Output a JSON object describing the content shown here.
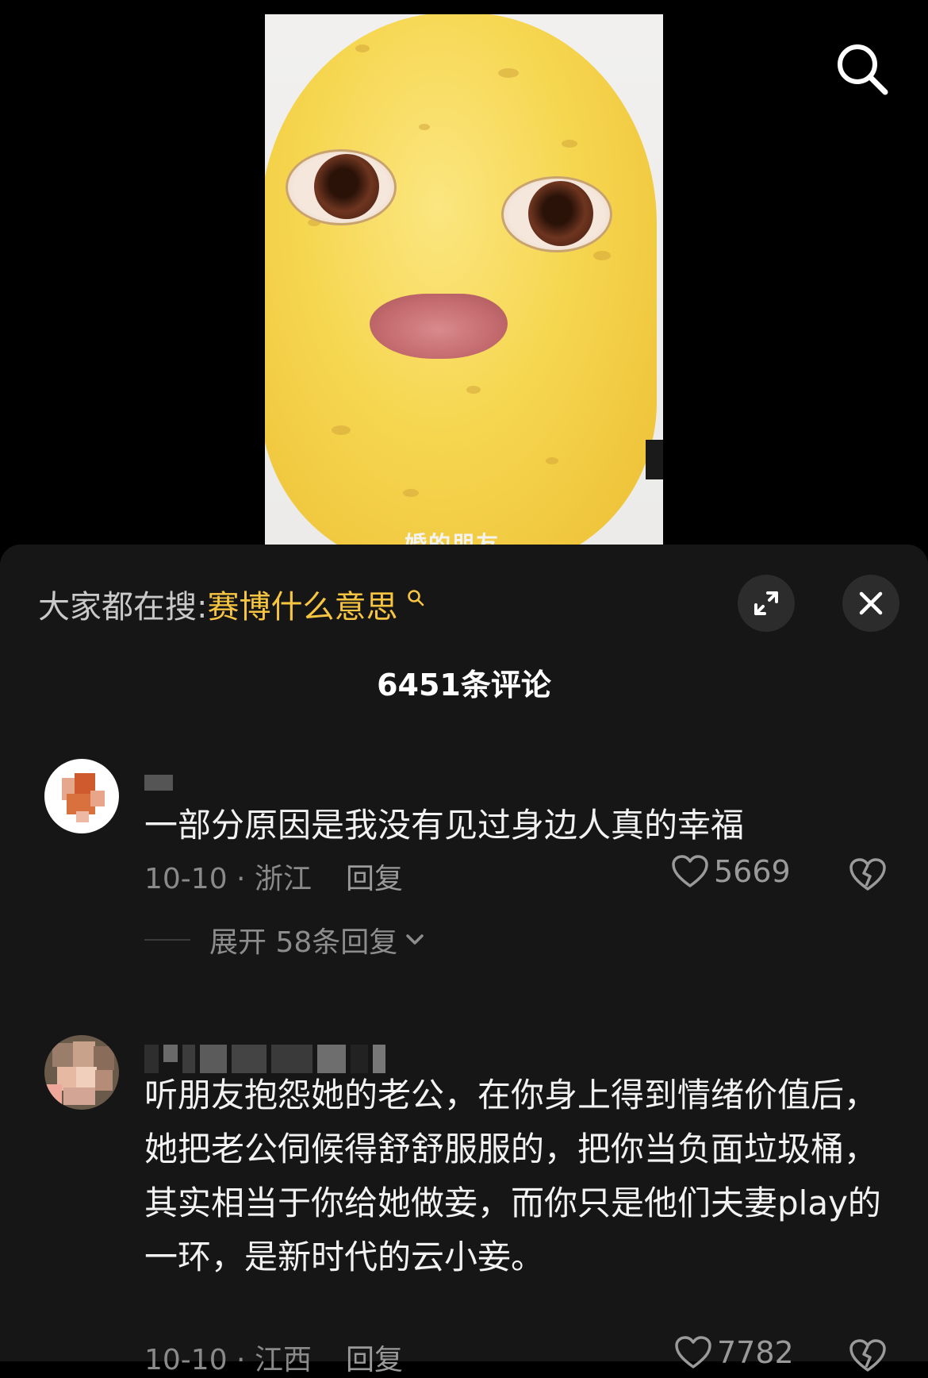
{
  "video": {
    "caption": "婚的朋友"
  },
  "top_bar": {
    "search_icon": "search-icon"
  },
  "hot_search": {
    "prefix": "大家都在搜:",
    "keyword": "赛博什么意思",
    "keyword_icon": "search-mini-icon"
  },
  "panel_buttons": {
    "expand_icon": "expand-icon",
    "close_icon": "close-icon"
  },
  "comments_header": {
    "title": "6451条评论"
  },
  "comments": [
    {
      "text": "一部分原因是我没有见过身边人真的幸福",
      "date_location": "10-10 · 浙江",
      "reply_label": "回复",
      "likes": "5669",
      "expand_label": "展开 58条回复"
    },
    {
      "text": "听朋友抱怨她的老公，在你身上得到情绪价值后，她把老公伺候得舒舒服服的，把你当负面垃圾桶，其实相当于你给她做妾，而你只是他们夫妻play的一环，是新时代的云小妾。",
      "date_location": "10-10 · 江西",
      "reply_label": "回复",
      "likes": "7782"
    }
  ],
  "colors": {
    "panel_bg": "#161616",
    "keyword": "#f7c541",
    "meta_text": "#8a8a8a"
  }
}
